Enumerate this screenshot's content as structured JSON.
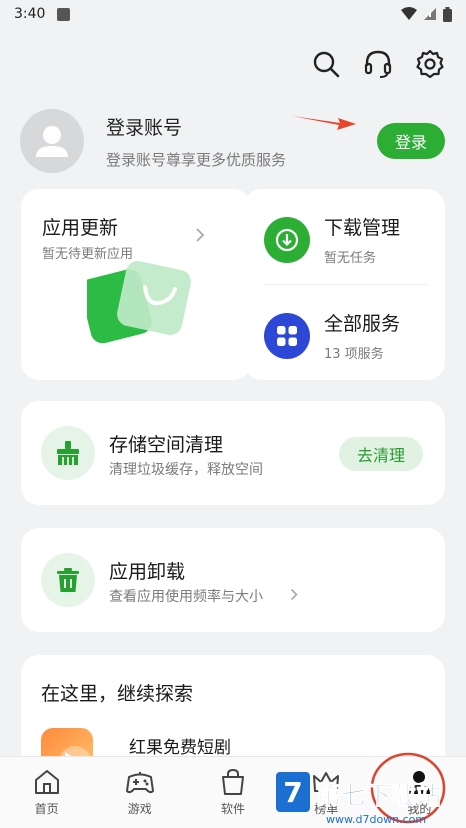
{
  "status": {
    "time": "3:40"
  },
  "profile": {
    "title": "登录账号",
    "subtitle": "登录账号尊享更多优质服务",
    "login_label": "登录"
  },
  "update_card": {
    "title": "应用更新",
    "subtitle": "暂无待更新应用"
  },
  "download": {
    "title": "下载管理",
    "subtitle": "暂无任务"
  },
  "all_services": {
    "title": "全部服务",
    "subtitle": "13 项服务"
  },
  "storage": {
    "title": "存储空间清理",
    "subtitle": "清理垃圾缓存，释放空间",
    "button": "去清理"
  },
  "uninstall": {
    "title": "应用卸载",
    "subtitle": "查看应用使用频率与大小"
  },
  "explore": {
    "title": "在这里，继续探索",
    "app_name": "红果免费短剧"
  },
  "tabs": [
    "首页",
    "游戏",
    "软件",
    "榜单",
    "我的"
  ],
  "watermark": {
    "brand": "第七下载站",
    "url": "www.d7down.com"
  },
  "colors": {
    "accent": "#2cae35",
    "blue": "#2d48d6",
    "background": "#f1f2f4"
  }
}
